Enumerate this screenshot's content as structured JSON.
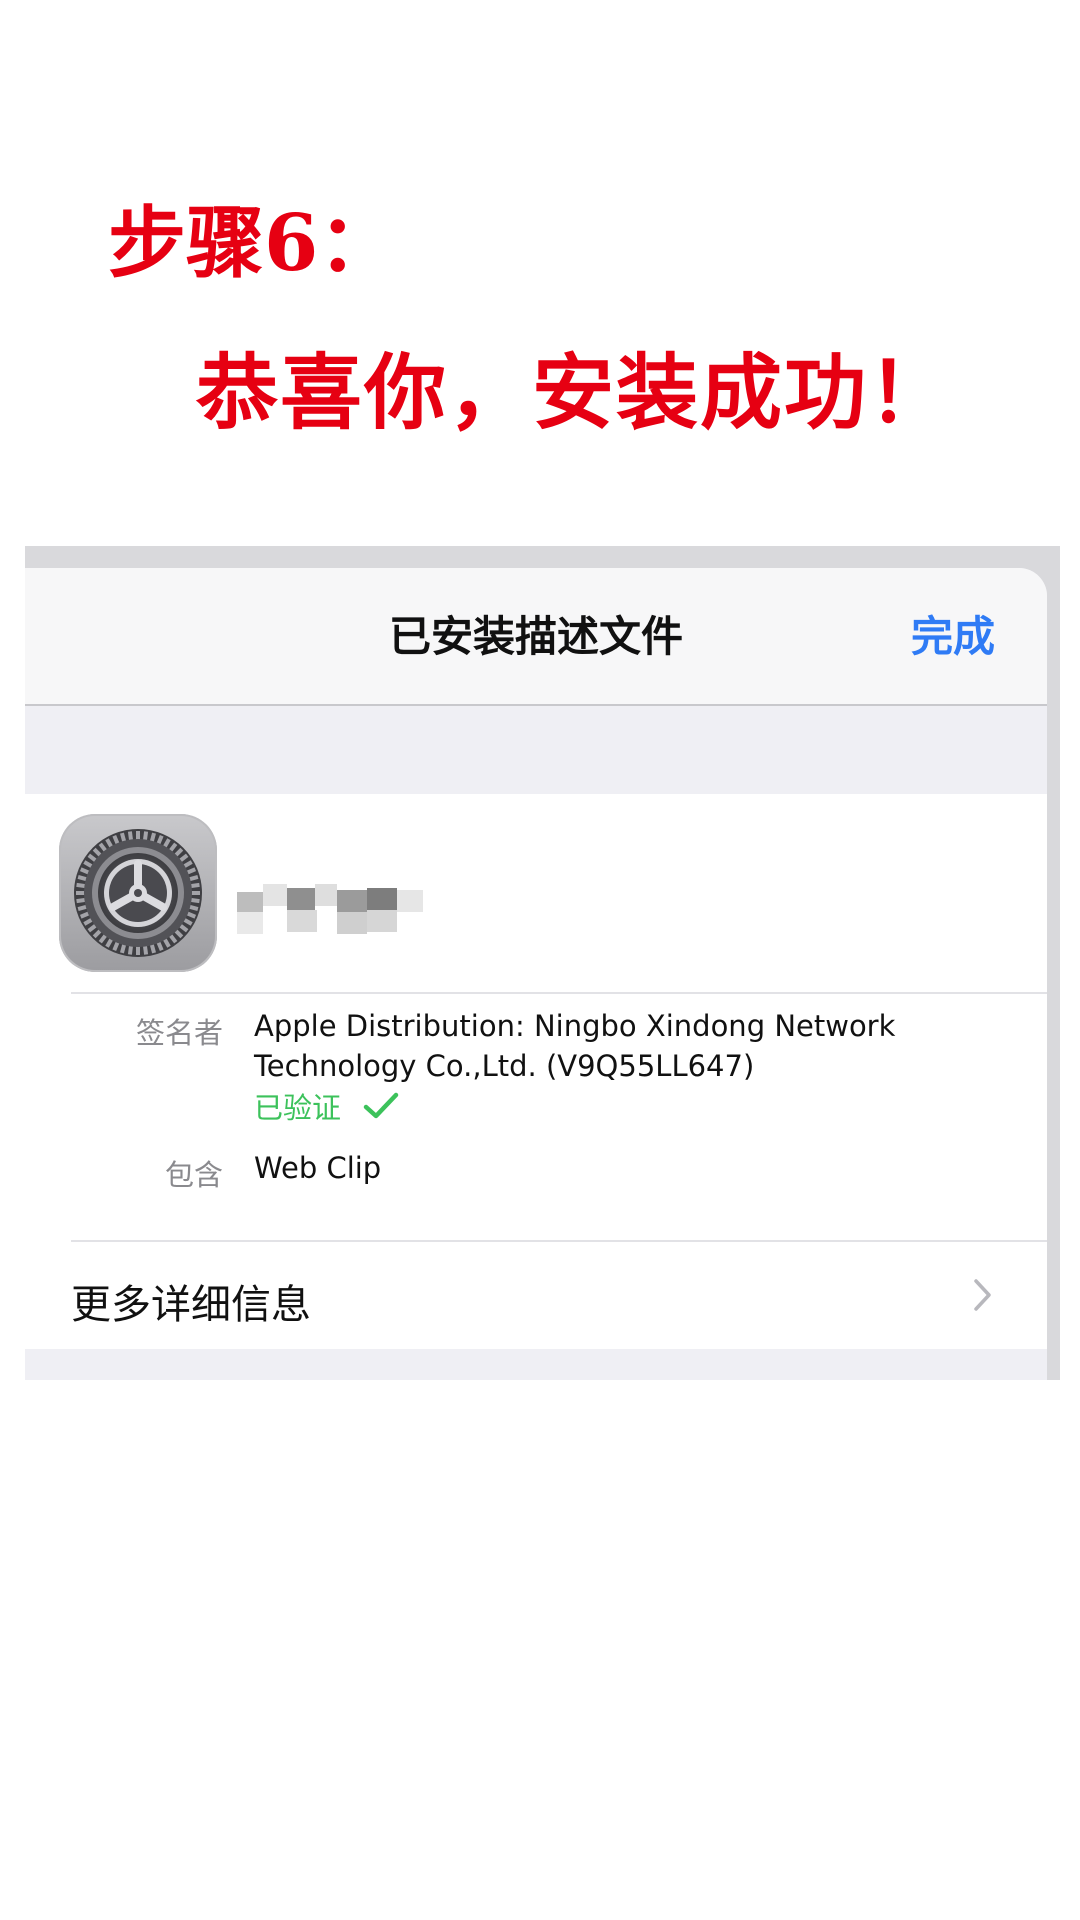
{
  "instruction": {
    "step": "步骤6：",
    "message": "恭喜你，安装成功！",
    "color": "#e60012"
  },
  "profile_sheet": {
    "title": "已安装描述文件",
    "done_label": "完成",
    "accent_color": "#2f7bf5",
    "app_icon": "settings-gear-icon",
    "profile_name_blurred": true,
    "signer_label": "签名者",
    "signer_line1": "Apple Distribution: Ningbo Xindong Network",
    "signer_line2": "Technology Co.,Ltd. (V9Q55LL647)",
    "verified_label": "已验证",
    "verified_color": "#3cc25b",
    "contains_label": "包含",
    "contains_value": "Web Clip",
    "more_details_label": "更多详细信息",
    "chevron_icon": "chevron-right-icon"
  }
}
